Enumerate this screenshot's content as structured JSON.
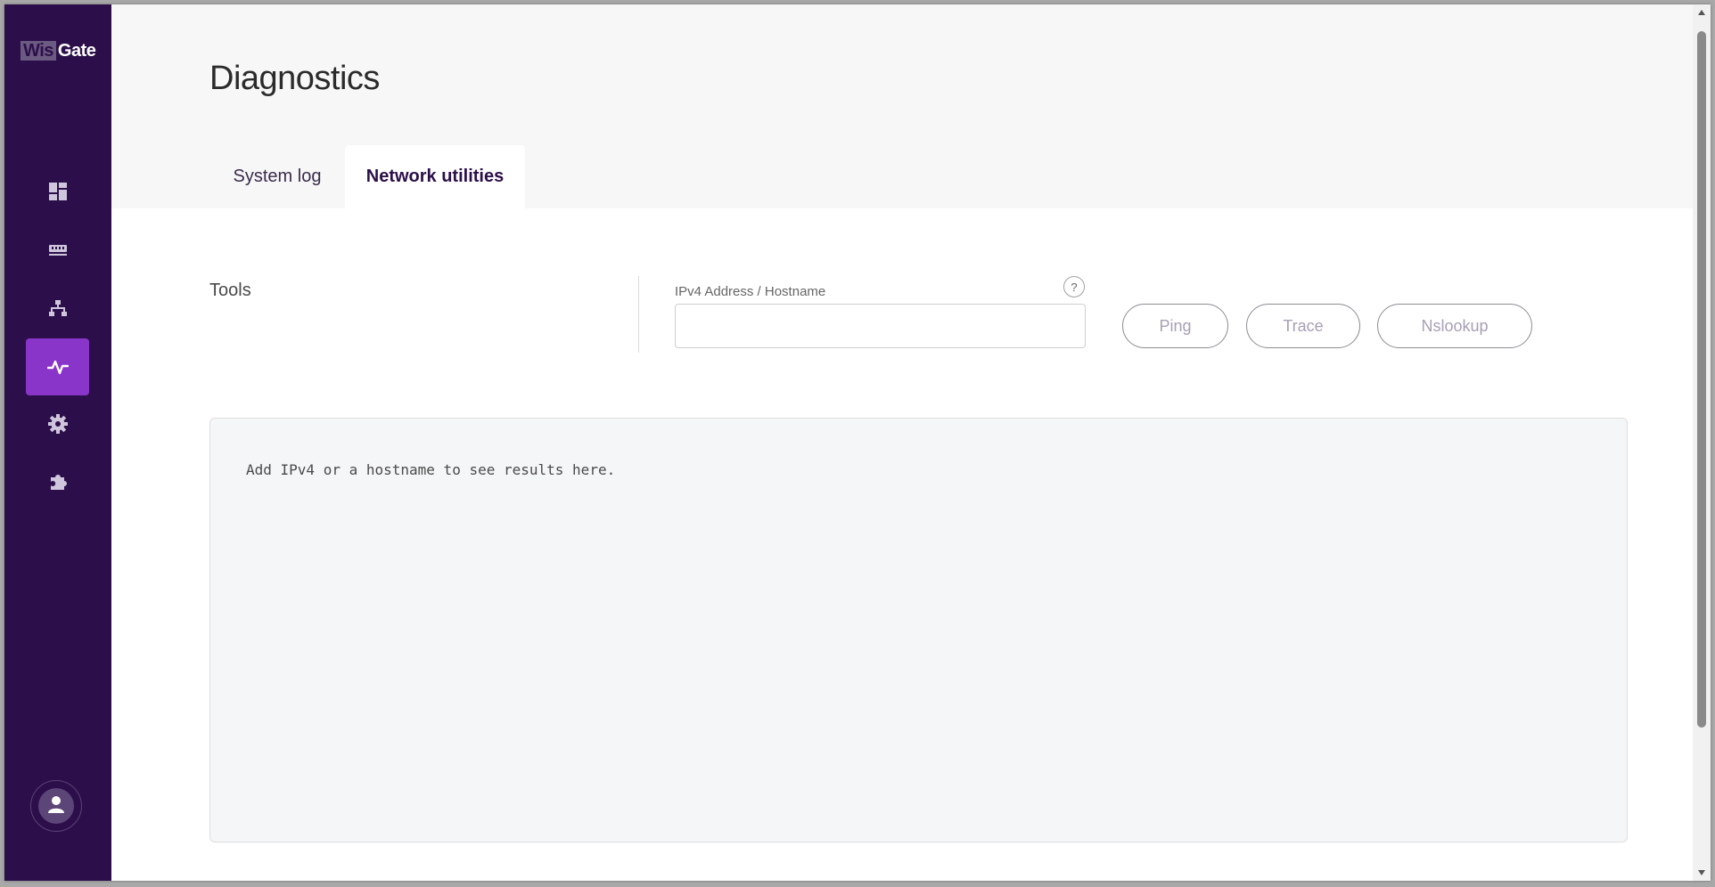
{
  "brand": {
    "logo_part1": "Wis",
    "logo_part2": "Gate"
  },
  "sidebar": {
    "items": [
      {
        "name": "dashboard",
        "icon": "dashboard-icon",
        "active": false
      },
      {
        "name": "devices",
        "icon": "router-icon",
        "active": false
      },
      {
        "name": "network",
        "icon": "network-tree-icon",
        "active": false
      },
      {
        "name": "diagnostics",
        "icon": "activity-pulse-icon",
        "active": true
      },
      {
        "name": "settings",
        "icon": "gear-icon",
        "active": false
      },
      {
        "name": "extensions",
        "icon": "puzzle-icon",
        "active": false
      }
    ],
    "user_icon": "user-icon"
  },
  "page": {
    "title": "Diagnostics"
  },
  "tabs": [
    {
      "label": "System log",
      "active": false
    },
    {
      "label": "Network utilities",
      "active": true
    }
  ],
  "tools": {
    "section_label": "Tools",
    "input_label": "IPv4 Address / Hostname",
    "input_value": "",
    "input_placeholder": "",
    "help_label": "?",
    "buttons": {
      "ping": "Ping",
      "trace": "Trace",
      "nslookup": "Nslookup"
    }
  },
  "results": {
    "text": "Add IPv4 or a hostname to see results here."
  },
  "colors": {
    "sidebar_bg": "#2c0f4a",
    "active_nav": "#8a35c9",
    "header_bg": "#f7f7f7",
    "results_bg": "#f5f6f8"
  }
}
